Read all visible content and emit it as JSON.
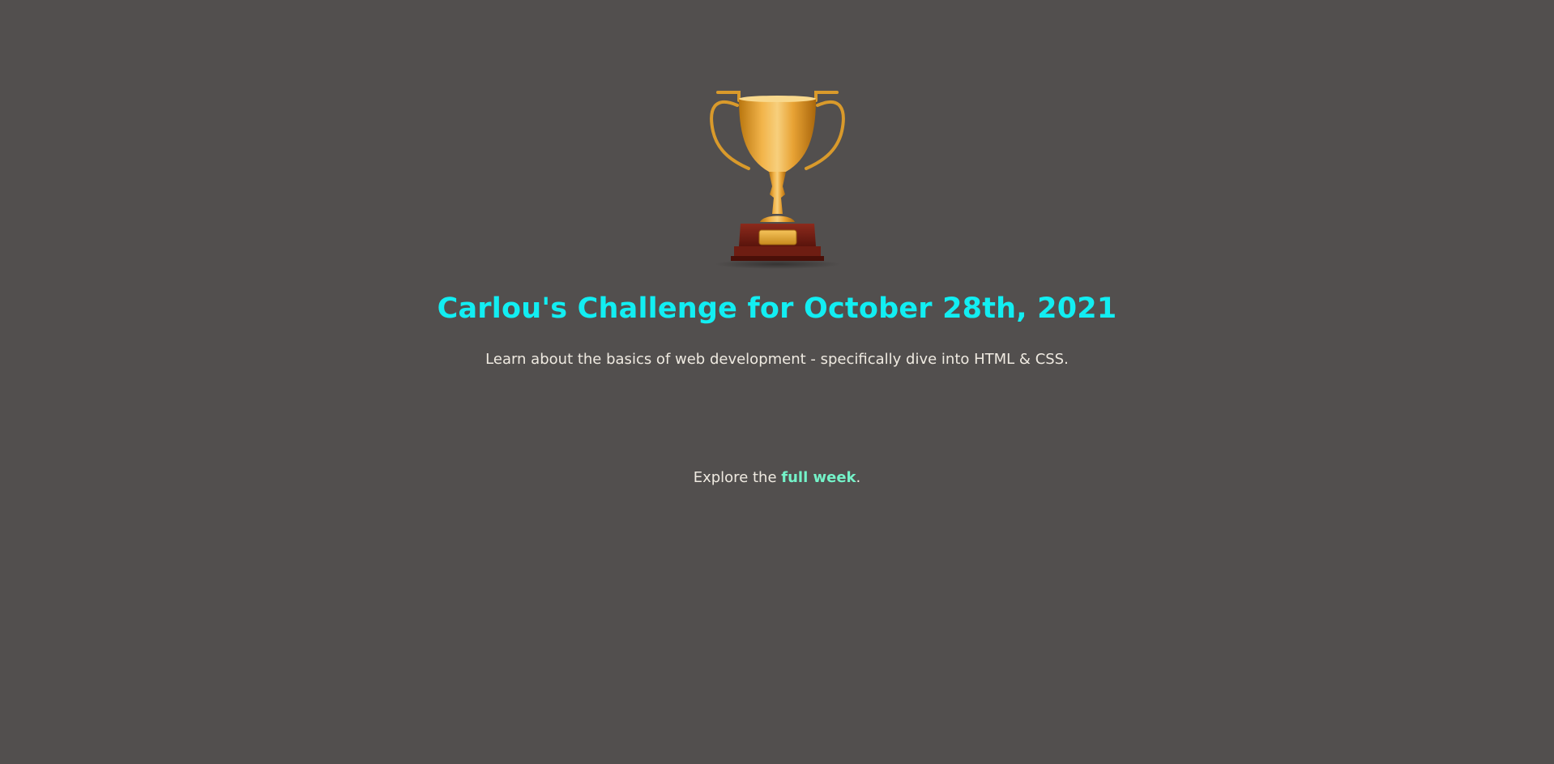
{
  "header": {
    "trophy_icon": "trophy-icon",
    "title": "Carlou's Challenge for October 28th, 2021",
    "subtitle": "Learn about the basics of web development - specifically dive into HTML & CSS."
  },
  "footer": {
    "explore_prefix": "Explore the ",
    "explore_link": "full week",
    "explore_suffix": "."
  },
  "colors": {
    "background": "#524f4e",
    "title": "#12eef2",
    "body_text": "#efeae1",
    "link": "#74f2c8"
  }
}
